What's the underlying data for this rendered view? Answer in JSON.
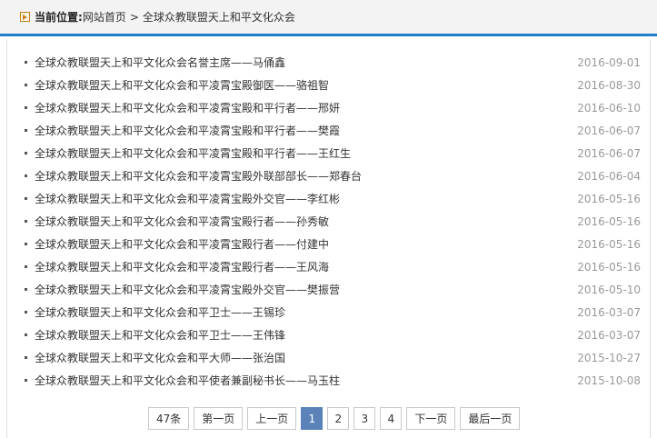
{
  "breadcrumb": {
    "label": "当前位置:",
    "home": "网站首页",
    "separator": ">",
    "current": "全球众教联盟天上和平文化众会"
  },
  "news": [
    {
      "title": "全球众教联盟天上和平文化众会名誉主席——马俑鑫",
      "date": "2016-09-01"
    },
    {
      "title": "全球众教联盟天上和平文化众会和平凌霄宝殿御医——骆祖智",
      "date": "2016-08-30"
    },
    {
      "title": "全球众教联盟天上和平文化众会和平凌霄宝殿和平行者——邢妍",
      "date": "2016-06-10"
    },
    {
      "title": "全球众教联盟天上和平文化众会和平凌霄宝殿和平行者——樊霞",
      "date": "2016-06-07"
    },
    {
      "title": "全球众教联盟天上和平文化众会和平凌霄宝殿和平行者——王红生",
      "date": "2016-06-07"
    },
    {
      "title": "全球众教联盟天上和平文化众会和平凌霄宝殿外联部部长——郑春台",
      "date": "2016-06-04"
    },
    {
      "title": "全球众教联盟天上和平文化众会和平凌霄宝殿外交官——李红彬",
      "date": "2016-05-16"
    },
    {
      "title": "全球众教联盟天上和平文化众会和平凌霄宝殿行者——孙秀敏",
      "date": "2016-05-16"
    },
    {
      "title": "全球众教联盟天上和平文化众会和平凌霄宝殿行者——付建中",
      "date": "2016-05-16"
    },
    {
      "title": "全球众教联盟天上和平文化众会和平凌霄宝殿行者——王风海",
      "date": "2016-05-16"
    },
    {
      "title": "全球众教联盟天上和平文化众会和平凌霄宝殿外交官——樊振营",
      "date": "2016-05-10"
    },
    {
      "title": "全球众教联盟天上和平文化众会和平卫士——王锡珍",
      "date": "2016-03-07"
    },
    {
      "title": "全球众教联盟天上和平文化众会和平卫士——王伟锋",
      "date": "2016-03-07"
    },
    {
      "title": "全球众教联盟天上和平文化众会和平大师——张治国",
      "date": "2015-10-27"
    },
    {
      "title": "全球众教联盟天上和平文化众会和平使者兼副秘书长——马玉柱",
      "date": "2015-10-08"
    }
  ],
  "pager": {
    "total": "47条",
    "first": "第一页",
    "prev": "上一页",
    "pages": [
      "1",
      "2",
      "3",
      "4"
    ],
    "current_page": "1",
    "next": "下一页",
    "last": "最后一页"
  },
  "colors": {
    "accent": "#1e7fc7",
    "active_page": "#5b82b9",
    "date_text": "#999999"
  }
}
